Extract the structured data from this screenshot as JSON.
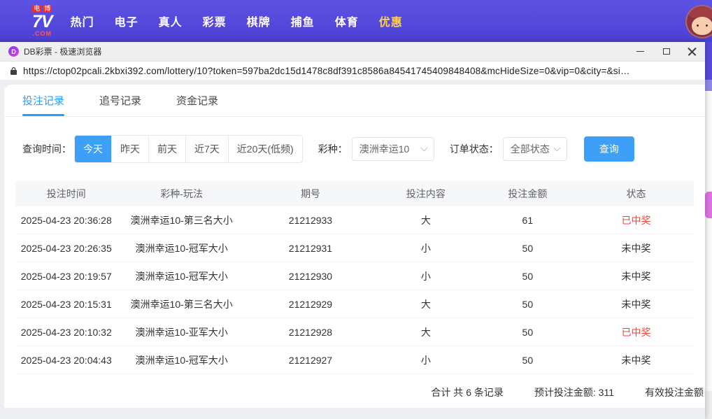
{
  "site_nav": {
    "logo": {
      "tag1": "电",
      "tag2": "博",
      "main": "7V",
      "com": ".COM"
    },
    "items": [
      {
        "label": "热门"
      },
      {
        "label": "电子"
      },
      {
        "label": "真人"
      },
      {
        "label": "彩票"
      },
      {
        "label": "棋牌"
      },
      {
        "label": "捕鱼"
      },
      {
        "label": "体育"
      },
      {
        "label": "优惠",
        "accent": "gold"
      }
    ]
  },
  "browser": {
    "favicon_letter": "D",
    "title": "DB彩票 - 极速浏览器",
    "url": "https://ctop02pcali.2kbxi392.com/lottery/10?token=597ba2dc15d1478c8df391c8586a84541745409848408&mcHideSize=0&vip=0&city=&si…"
  },
  "tabs": [
    {
      "label": "投注记录",
      "state": "active"
    },
    {
      "label": "追号记录"
    },
    {
      "label": "资金记录"
    }
  ],
  "filters": {
    "time_label": "查询时间：",
    "time_options": [
      {
        "label": "今天",
        "state": "active"
      },
      {
        "label": "昨天"
      },
      {
        "label": "前天"
      },
      {
        "label": "近7天"
      },
      {
        "label": "近20天(低频)"
      }
    ],
    "lottery_label": "彩种：",
    "lottery_value": "澳洲幸运10",
    "status_label": "订单状态：",
    "status_value": "全部状态",
    "search_label": "查询"
  },
  "table": {
    "headers": [
      "投注时间",
      "彩种-玩法",
      "期号",
      "投注内容",
      "投注金额",
      "状态"
    ],
    "rows": [
      {
        "time": "2025-04-23 20:36:28",
        "play": "澳洲幸运10-第三名大小",
        "issue": "21212933",
        "content": "大",
        "amount": "61",
        "status": "已中奖",
        "state": "win"
      },
      {
        "time": "2025-04-23 20:26:35",
        "play": "澳洲幸运10-冠军大小",
        "issue": "21212931",
        "content": "小",
        "amount": "50",
        "status": "未中奖",
        "state": "lose"
      },
      {
        "time": "2025-04-23 20:19:57",
        "play": "澳洲幸运10-冠军大小",
        "issue": "21212930",
        "content": "小",
        "amount": "50",
        "status": "未中奖",
        "state": "lose"
      },
      {
        "time": "2025-04-23 20:15:31",
        "play": "澳洲幸运10-第三名大小",
        "issue": "21212929",
        "content": "大",
        "amount": "50",
        "status": "未中奖",
        "state": "lose"
      },
      {
        "time": "2025-04-23 20:10:32",
        "play": "澳洲幸运10-亚军大小",
        "issue": "21212928",
        "content": "大",
        "amount": "50",
        "status": "已中奖",
        "state": "win"
      },
      {
        "time": "2025-04-23 20:04:43",
        "play": "澳洲幸运10-冠军大小",
        "issue": "21212927",
        "content": "小",
        "amount": "50",
        "status": "未中奖",
        "state": "lose"
      }
    ]
  },
  "summary": {
    "total": "合计 共 6 条记录",
    "expected": "预计投注金额: 311",
    "valid": "有效投注金额"
  },
  "colors": {
    "accent_blue": "#3d9ff5",
    "win_red": "#f2463a",
    "nav_purple": "#4c40d4",
    "highlight_gold": "#ffd24a"
  }
}
